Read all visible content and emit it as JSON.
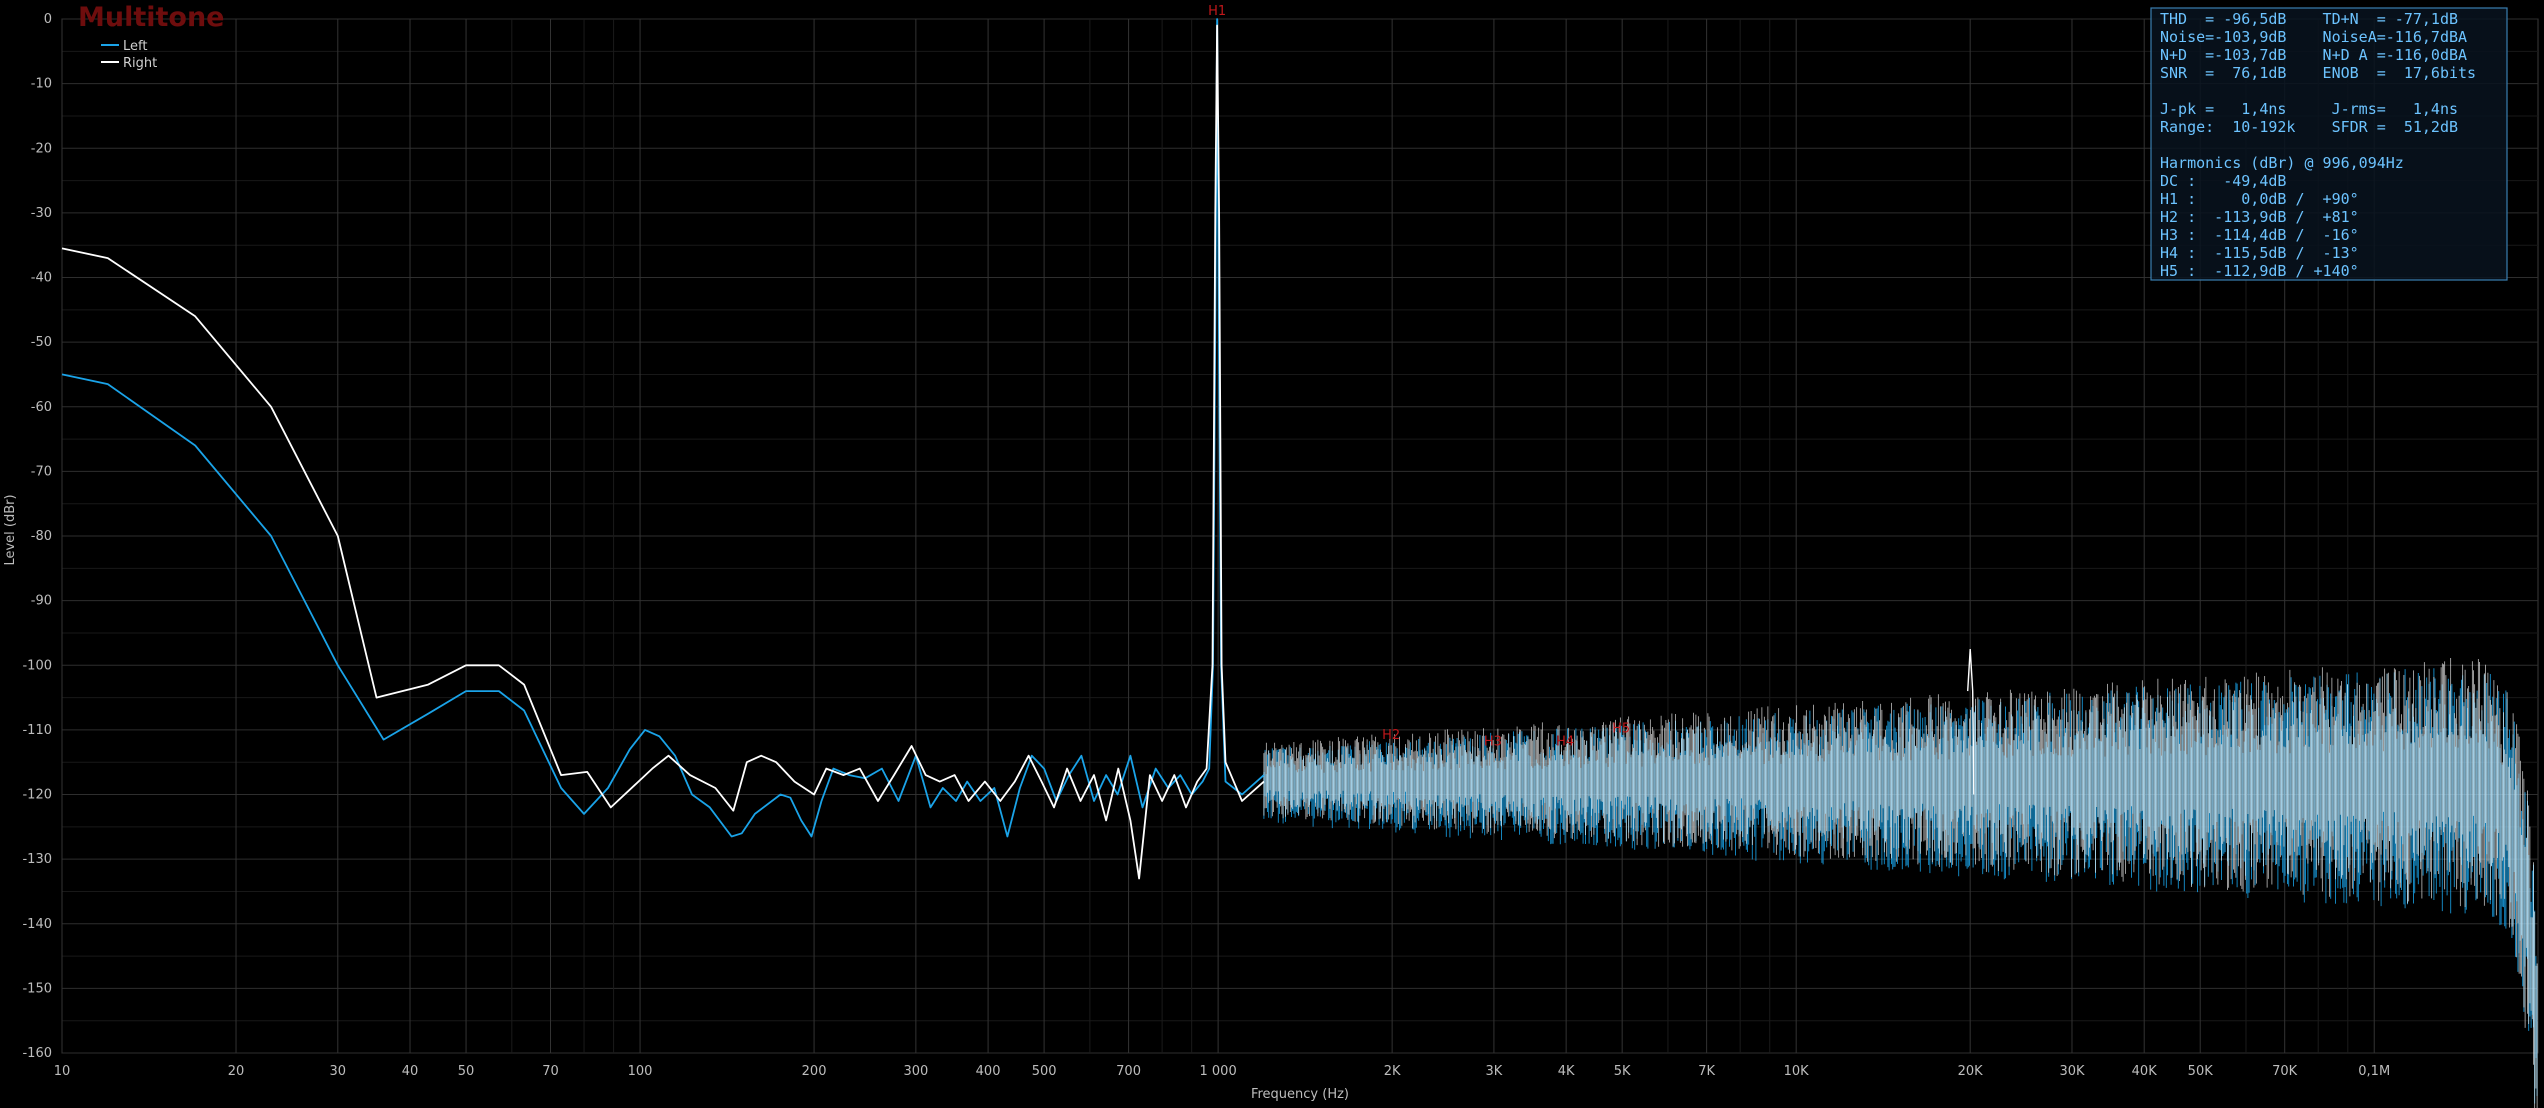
{
  "app": {
    "watermark": "Multitone"
  },
  "legend": [
    {
      "name": "Left",
      "color": "#1aa3e8"
    },
    {
      "name": "Right",
      "color": "#ffffff"
    }
  ],
  "colors": {
    "background": "#000000",
    "grid": "#2f2f2f",
    "harmonic_label": "#c0181b",
    "stats_text": "#6cc3ff",
    "stats_border": "#3a7fb0",
    "stats_bg": "#0b1a28"
  },
  "stats_panel": {
    "lines": [
      "THD  = -96,5dB    TD+N  = -77,1dB",
      "Noise=-103,9dB    NoiseA=-116,7dBA",
      "N+D  =-103,7dB    N+D A =-116,0dBA",
      "SNR  =  76,1dB    ENOB  =  17,6bits",
      "",
      "J-pk =   1,4ns     J-rms=   1,4ns",
      "Range:  10-192k    SFDR =  51,2dB",
      "",
      "Harmonics (dBr) @ 996,094Hz",
      "DC :   -49,4dB",
      "H1 :     0,0dB /  +90°",
      "H2 :  -113,9dB /  +81°",
      "H3 :  -114,4dB /  -16°",
      "H4 :  -115,5dB /  -13°",
      "H5 :  -112,9dB / +140°"
    ]
  },
  "chart_data": {
    "type": "line",
    "title": "",
    "xlabel": "Frequency (Hz)",
    "ylabel": "Level (dBr)",
    "xscale": "log",
    "xlim": [
      10,
      192000
    ],
    "ylim": [
      -160,
      0
    ],
    "x_ticks": [
      {
        "value": 10,
        "label": "10"
      },
      {
        "value": 20,
        "label": "20"
      },
      {
        "value": 30,
        "label": "30"
      },
      {
        "value": 40,
        "label": "40"
      },
      {
        "value": 50,
        "label": "50"
      },
      {
        "value": 70,
        "label": "70"
      },
      {
        "value": 100,
        "label": "100"
      },
      {
        "value": 200,
        "label": "200"
      },
      {
        "value": 300,
        "label": "300"
      },
      {
        "value": 400,
        "label": "400"
      },
      {
        "value": 500,
        "label": "500"
      },
      {
        "value": 700,
        "label": "700"
      },
      {
        "value": 1000,
        "label": "1 000"
      },
      {
        "value": 2000,
        "label": "2K"
      },
      {
        "value": 3000,
        "label": "3K"
      },
      {
        "value": 4000,
        "label": "4K"
      },
      {
        "value": 5000,
        "label": "5K"
      },
      {
        "value": 7000,
        "label": "7K"
      },
      {
        "value": 10000,
        "label": "10K"
      },
      {
        "value": 20000,
        "label": "20K"
      },
      {
        "value": 30000,
        "label": "30K"
      },
      {
        "value": 40000,
        "label": "40K"
      },
      {
        "value": 50000,
        "label": "50K"
      },
      {
        "value": 70000,
        "label": "70K"
      },
      {
        "value": 100000,
        "label": "0,1M"
      }
    ],
    "y_ticks": [
      0,
      -10,
      -20,
      -30,
      -40,
      -50,
      -60,
      -70,
      -80,
      -90,
      -100,
      -110,
      -120,
      -130,
      -140,
      -150,
      -160
    ],
    "harmonic_markers": [
      {
        "label": "H1",
        "x": 996,
        "y": 0
      },
      {
        "label": "H2",
        "x": 1992,
        "y": -112
      },
      {
        "label": "H3",
        "x": 2988,
        "y": -113
      },
      {
        "label": "H4",
        "x": 3984,
        "y": -113
      },
      {
        "label": "H5",
        "x": 4980,
        "y": -111
      }
    ],
    "series": [
      {
        "name": "Left",
        "color": "#1aa3e8",
        "points": [
          [
            10,
            -55
          ],
          [
            12,
            -56.5
          ],
          [
            17,
            -66
          ],
          [
            23,
            -80
          ],
          [
            30,
            -100
          ],
          [
            36,
            -111.5
          ],
          [
            43,
            -107.5
          ],
          [
            50,
            -104
          ],
          [
            57,
            -104
          ],
          [
            63,
            -107
          ],
          [
            73,
            -119
          ],
          [
            80,
            -123
          ],
          [
            88,
            -119
          ],
          [
            96,
            -113
          ],
          [
            102,
            -110
          ],
          [
            108,
            -111
          ],
          [
            115,
            -114
          ],
          [
            123,
            -120
          ],
          [
            132,
            -122
          ],
          [
            144,
            -126.5
          ],
          [
            150,
            -126
          ],
          [
            158,
            -123
          ],
          [
            175,
            -120
          ],
          [
            182,
            -120.5
          ],
          [
            190,
            -124
          ],
          [
            198,
            -126.5
          ],
          [
            206,
            -121
          ],
          [
            216,
            -116
          ],
          [
            230,
            -117
          ],
          [
            245,
            -117.5
          ],
          [
            262,
            -116
          ],
          [
            280,
            -121
          ],
          [
            300,
            -114
          ],
          [
            318,
            -122
          ],
          [
            334,
            -119
          ],
          [
            352,
            -121
          ],
          [
            368,
            -118
          ],
          [
            388,
            -121
          ],
          [
            410,
            -119
          ],
          [
            432,
            -126.5
          ],
          [
            454,
            -119
          ],
          [
            476,
            -114
          ],
          [
            500,
            -116
          ],
          [
            525,
            -121
          ],
          [
            552,
            -117
          ],
          [
            580,
            -114
          ],
          [
            610,
            -121
          ],
          [
            640,
            -117
          ],
          [
            670,
            -120
          ],
          [
            705,
            -114
          ],
          [
            740,
            -122
          ],
          [
            780,
            -116
          ],
          [
            820,
            -119
          ],
          [
            860,
            -117
          ],
          [
            900,
            -120
          ],
          [
            940,
            -118
          ],
          [
            965,
            -116
          ],
          [
            980,
            -100
          ],
          [
            990,
            -40
          ],
          [
            996,
            0
          ],
          [
            1002,
            -40
          ],
          [
            1012,
            -100
          ],
          [
            1030,
            -118
          ],
          [
            1100,
            -120
          ],
          [
            1200,
            -117
          ]
        ]
      },
      {
        "name": "Right",
        "color": "#ffffff",
        "points": [
          [
            10,
            -35.5
          ],
          [
            12,
            -37
          ],
          [
            17,
            -46
          ],
          [
            23,
            -60
          ],
          [
            30,
            -80
          ],
          [
            35,
            -105
          ],
          [
            43,
            -103
          ],
          [
            50,
            -100
          ],
          [
            57,
            -100
          ],
          [
            63,
            -103
          ],
          [
            73,
            -117
          ],
          [
            81,
            -116.5
          ],
          [
            89,
            -122
          ],
          [
            98,
            -118.5
          ],
          [
            105,
            -116
          ],
          [
            112,
            -114
          ],
          [
            122,
            -117
          ],
          [
            135,
            -119
          ],
          [
            145,
            -122.5
          ],
          [
            153,
            -115
          ],
          [
            162,
            -114
          ],
          [
            172,
            -115
          ],
          [
            185,
            -118
          ],
          [
            200,
            -120
          ],
          [
            210,
            -116
          ],
          [
            225,
            -117
          ],
          [
            240,
            -116
          ],
          [
            258,
            -121
          ],
          [
            275,
            -117
          ],
          [
            295,
            -112.5
          ],
          [
            312,
            -117
          ],
          [
            330,
            -118
          ],
          [
            350,
            -117
          ],
          [
            370,
            -121
          ],
          [
            395,
            -118
          ],
          [
            420,
            -121
          ],
          [
            445,
            -118
          ],
          [
            470,
            -114
          ],
          [
            495,
            -118
          ],
          [
            520,
            -122
          ],
          [
            548,
            -116
          ],
          [
            578,
            -121
          ],
          [
            610,
            -117
          ],
          [
            640,
            -124
          ],
          [
            672,
            -116
          ],
          [
            705,
            -124
          ],
          [
            730,
            -133
          ],
          [
            762,
            -117
          ],
          [
            800,
            -121
          ],
          [
            840,
            -117
          ],
          [
            880,
            -122
          ],
          [
            920,
            -118
          ],
          [
            955,
            -116
          ],
          [
            978,
            -100
          ],
          [
            989,
            -30
          ],
          [
            996,
            -1
          ],
          [
            1004,
            -30
          ],
          [
            1014,
            -100
          ],
          [
            1030,
            -115
          ],
          [
            1100,
            -121
          ],
          [
            1200,
            -118
          ]
        ]
      }
    ],
    "noise_floor": {
      "description_free": true,
      "x_range": [
        1200,
        192000
      ],
      "center": -118,
      "left_upper_peaks": [
        [
          19800,
          -104
        ],
        [
          20000,
          -97.5
        ],
        [
          20200,
          -104
        ]
      ],
      "rolloff": [
        [
          160000,
          -118
        ],
        [
          175000,
          -125
        ],
        [
          185000,
          -140
        ],
        [
          192000,
          -158
        ]
      ]
    }
  }
}
